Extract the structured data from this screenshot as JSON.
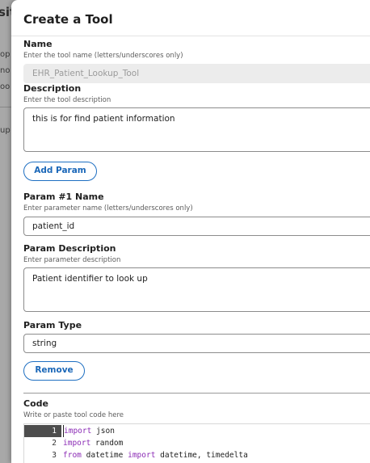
{
  "background": {
    "title_fragment": "sit",
    "fragments": [
      "op",
      "no",
      "oo",
      "up"
    ]
  },
  "modal": {
    "title": "Create a Tool",
    "name": {
      "label": "Name",
      "hint": "Enter the tool name (letters/underscores only)",
      "value": "EHR_Patient_Lookup_Tool"
    },
    "description": {
      "label": "Description",
      "hint": "Enter the tool description",
      "value": "this is for find patient information"
    },
    "add_param_label": "Add Param",
    "param": {
      "name_label": "Param #1 Name",
      "name_hint": "Enter parameter name (letters/underscores only)",
      "name_value": "patient_id",
      "desc_label": "Param Description",
      "desc_hint": "Enter parameter description",
      "desc_value": "Patient identifier to look up",
      "type_label": "Param Type",
      "type_value": "string",
      "remove_label": "Remove"
    },
    "code": {
      "label": "Code",
      "hint": "Write or paste tool code here",
      "lines": [
        {
          "num": "1",
          "kw1": "import",
          "rest1": " json",
          "kw2": "",
          "rest2": ""
        },
        {
          "num": "2",
          "kw1": "import",
          "rest1": " random",
          "kw2": "",
          "rest2": ""
        },
        {
          "num": "3",
          "kw1": "from",
          "rest1": " datetime ",
          "kw2": "import",
          "rest2": " datetime, timedelta"
        }
      ]
    }
  }
}
